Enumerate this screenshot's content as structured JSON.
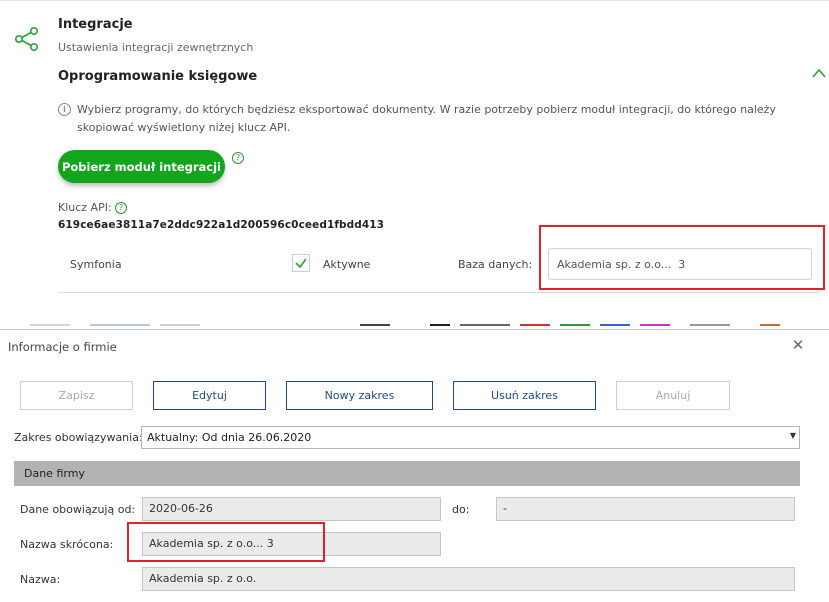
{
  "integration": {
    "title": "Integracje",
    "subtitle": "Ustawienia integracji zewnętrznych",
    "section_title": "Oprogramowanie księgowe",
    "info_text": "Wybierz programy, do których będziesz eksportować dokumenty. W razie potrzeby pobierz moduł integracji, do którego należy skopiować wyświetlony niżej klucz API.",
    "download_button": "Pobierz moduł integracji",
    "api_label": "Klucz API:",
    "api_key": "619ce6ae3811a7e2ddc922a1d200596c0ceed1fbdd413",
    "program_row": {
      "name": "Symfonia",
      "active_label": "Aktywne",
      "active_checked": false,
      "db_label": "Baza danych:",
      "db_value": "Akademia sp. z o.o...  3"
    },
    "accent_color": "#13a51c",
    "highlight_color": "#e0232a"
  },
  "dialog": {
    "title": "Informacje o firmie",
    "buttons": {
      "save": "Zapisz",
      "edit": "Edytuj",
      "new_range": "Nowy zakres",
      "delete_range": "Usuń zakres",
      "cancel": "Anuluj"
    },
    "range_label": "Zakres obowiązywania:",
    "range_value": "Aktualny: Od dnia 26.06.2020",
    "section": "Dane firmy",
    "valid_from_label": "Dane obowiązują od:",
    "valid_from_value": "2020-06-26",
    "to_label": "do:",
    "to_value": "-",
    "short_name_label": "Nazwa skrócona:",
    "short_name_value": "Akademia sp. z o.o...  3",
    "name_label": "Nazwa:",
    "name_value": "Akademia sp. z o.o."
  },
  "icons": {
    "share": "share-icon",
    "collapse": "chevron-up-icon",
    "info": "info-icon",
    "help": "help-icon",
    "close": "close-icon",
    "dropdown": "dropdown-arrow-icon"
  }
}
